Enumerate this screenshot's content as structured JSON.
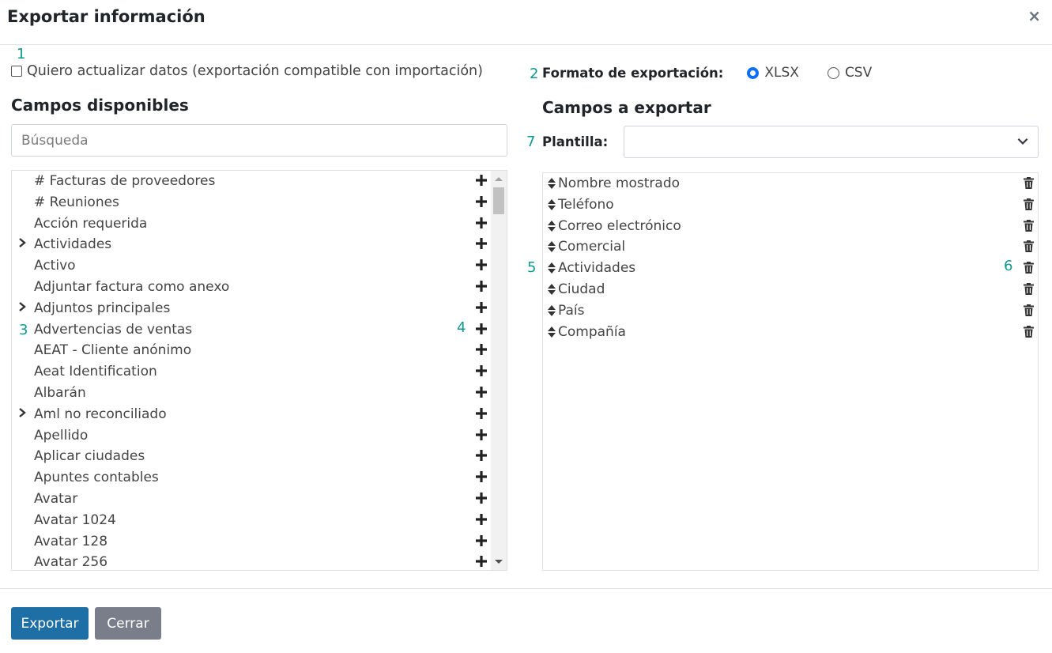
{
  "dialog": {
    "title": "Exportar información",
    "close_symbol": "×"
  },
  "annotations": {
    "a1": "1",
    "a2": "2",
    "a3": "3",
    "a4": "4",
    "a5": "5",
    "a6": "6",
    "a7": "7"
  },
  "update_option": {
    "label": "Quiero actualizar datos (exportación compatible con importación)",
    "checked": false
  },
  "format": {
    "label": "Formato de exportación:",
    "options": [
      {
        "label": "XLSX",
        "checked": true
      },
      {
        "label": "CSV",
        "checked": false
      }
    ]
  },
  "available": {
    "title": "Campos disponibles",
    "search_placeholder": "Búsqueda",
    "items": [
      {
        "label": "# Facturas de proveedores",
        "expandable": false
      },
      {
        "label": "# Reuniones",
        "expandable": false
      },
      {
        "label": "Acción requerida",
        "expandable": false
      },
      {
        "label": "Actividades",
        "expandable": true
      },
      {
        "label": "Activo",
        "expandable": false
      },
      {
        "label": "Adjuntar factura como anexo",
        "expandable": false
      },
      {
        "label": "Adjuntos principales",
        "expandable": true
      },
      {
        "label": "Advertencias de ventas",
        "expandable": false
      },
      {
        "label": "AEAT - Cliente anónimo",
        "expandable": false
      },
      {
        "label": "Aeat Identification",
        "expandable": false
      },
      {
        "label": "Albarán",
        "expandable": false
      },
      {
        "label": "Aml no reconciliado",
        "expandable": true
      },
      {
        "label": "Apellido",
        "expandable": false
      },
      {
        "label": "Aplicar ciudades",
        "expandable": false
      },
      {
        "label": "Apuntes contables",
        "expandable": false
      },
      {
        "label": "Avatar",
        "expandable": false
      },
      {
        "label": "Avatar 1024",
        "expandable": false
      },
      {
        "label": "Avatar 128",
        "expandable": false
      },
      {
        "label": "Avatar 256",
        "expandable": false
      }
    ]
  },
  "export_fields": {
    "title": "Campos a exportar",
    "template_label": "Plantilla:",
    "template_value": "",
    "items": [
      "Nombre mostrado",
      "Teléfono",
      "Correo electrónico",
      "Comercial",
      "Actividades",
      "Ciudad",
      "País",
      "Compañía"
    ]
  },
  "footer": {
    "export_label": "Exportar",
    "close_label": "Cerrar"
  },
  "colors": {
    "primary": "#1f6fa7",
    "secondary": "#7a7e8a",
    "annotation": "#0e9a8f",
    "radio": "#0d6efd"
  }
}
